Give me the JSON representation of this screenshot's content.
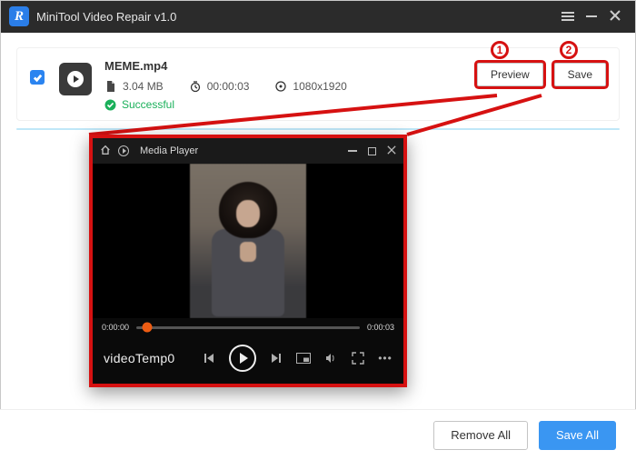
{
  "app": {
    "title": "MiniTool Video Repair v1.0",
    "logo_letter": "R"
  },
  "file": {
    "name": "MEME.mp4",
    "size": "3.04 MB",
    "duration": "00:00:03",
    "resolution": "1080x1920",
    "status": "Successful",
    "preview_label": "Preview",
    "save_label": "Save"
  },
  "player": {
    "title": "Media Player",
    "name": "videoTemp0",
    "time_current": "0:00:00",
    "time_total": "0:00:03"
  },
  "footer": {
    "remove_all": "Remove All",
    "save_all": "Save All"
  },
  "annot": {
    "one": "1",
    "two": "2"
  }
}
